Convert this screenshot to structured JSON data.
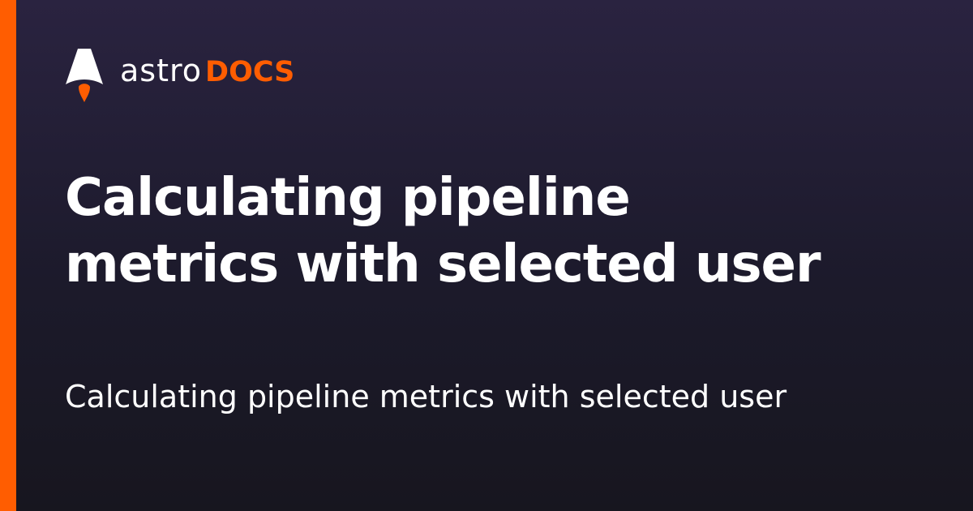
{
  "brand": {
    "name": "astro",
    "product": "DOCS",
    "accent_color": "#ff5d01",
    "icon": "astro-rocket-icon"
  },
  "page": {
    "title": "Calculating pipeline metrics with selected user",
    "description": "Calculating pipeline metrics with selected user"
  },
  "colors": {
    "background": "#1c1a2b",
    "text": "#ffffff",
    "accent": "#ff5d01"
  }
}
